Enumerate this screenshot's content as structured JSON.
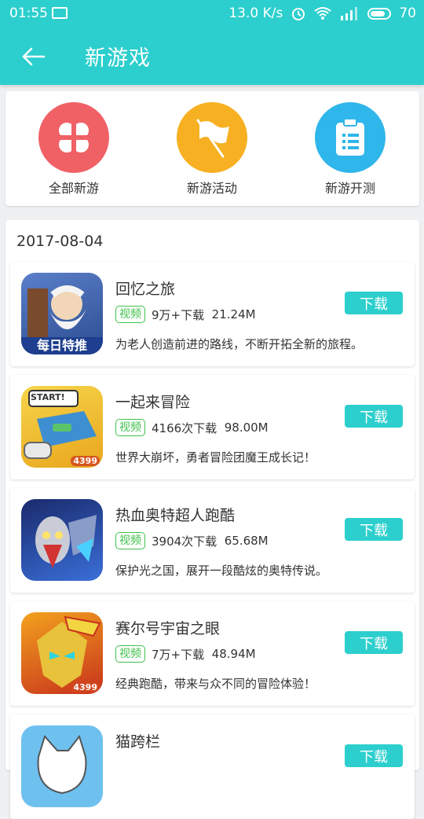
{
  "status": {
    "time": "01:55",
    "speed": "13.0 K/s",
    "battery": "70"
  },
  "header": {
    "title": "新游戏"
  },
  "categories": [
    {
      "label": "全部新游",
      "color": "#f06166",
      "icon": "grid-icon"
    },
    {
      "label": "新游活动",
      "color": "#f6b021",
      "icon": "flag-icon"
    },
    {
      "label": "新游开测",
      "color": "#2fb6ea",
      "icon": "clipboard-icon"
    }
  ],
  "list": {
    "date": "2017-08-04",
    "items": [
      {
        "name": "回忆之旅",
        "tag": "视频",
        "downloads": "9万+下载",
        "size": "21.24M",
        "desc": "为老人创造前进的路线，不断开拓全新的旅程。",
        "button": "下载",
        "icon_badge": "每日特推"
      },
      {
        "name": "一起来冒险",
        "tag": "视频",
        "downloads": "4166次下载",
        "size": "98.00M",
        "desc": "世界大崩坏，勇者冒险团魔王成长记！",
        "button": "下载",
        "icon_badge": "START!",
        "icon_brand": "4399"
      },
      {
        "name": "热血奥特超人跑酷",
        "tag": "视频",
        "downloads": "3904次下载",
        "size": "65.68M",
        "desc": "保护光之国，展开一段酷炫的奥特传说。",
        "button": "下载"
      },
      {
        "name": "赛尔号宇宙之眼",
        "tag": "视频",
        "downloads": "7万+下载",
        "size": "48.94M",
        "desc": "经典跑酷，带来与众不同的冒险体验！",
        "button": "下载",
        "icon_brand": "4399"
      },
      {
        "name": "猫跨栏",
        "button": "下载"
      }
    ]
  }
}
